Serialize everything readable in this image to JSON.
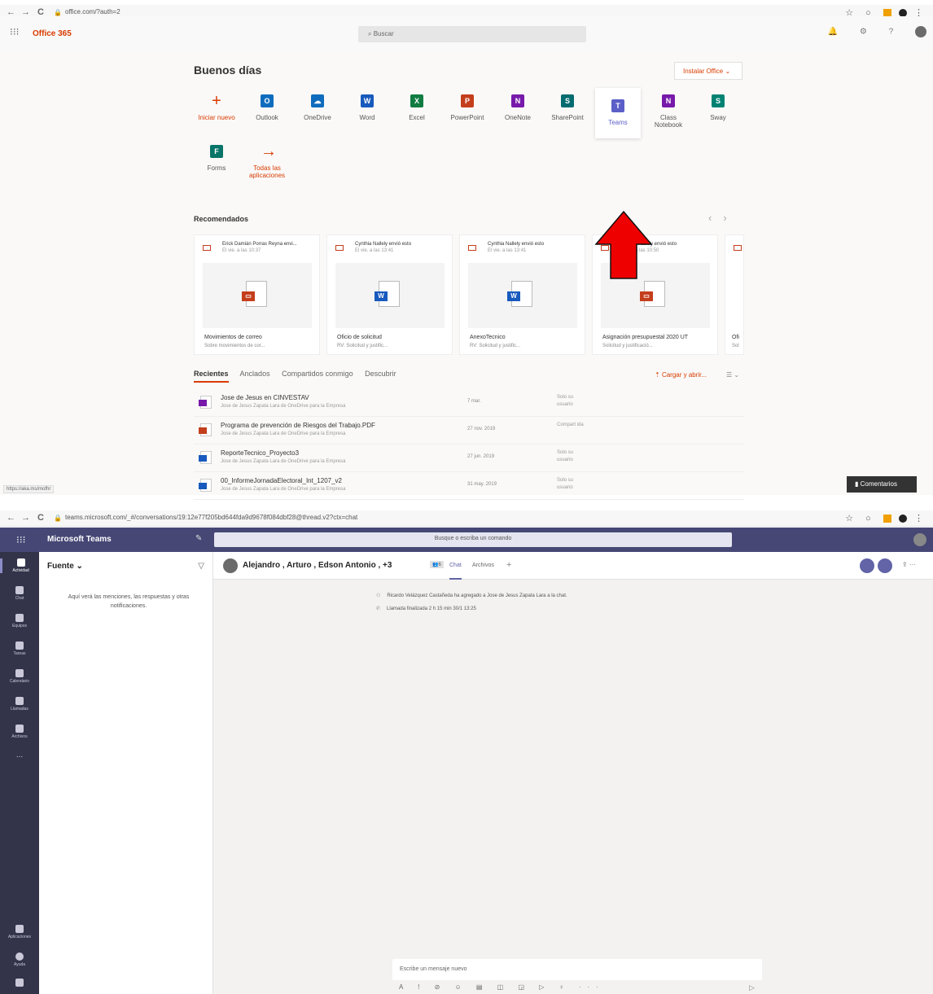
{
  "browser1": {
    "back": "←",
    "forward": "→",
    "reload": "C",
    "lock": "🔒",
    "url": "office.com/?auth=2"
  },
  "office": {
    "waffle": "⁝⁝⁝",
    "title": "Office 365",
    "search_placeholder": "Buscar",
    "greeting": "Buenos días",
    "install_label": "Instalar Office",
    "apps": [
      {
        "label": "Iniciar nuevo",
        "icon": "+",
        "color": "#d83b01"
      },
      {
        "label": "Outlook",
        "icon": "O",
        "color": "#0f6cbd"
      },
      {
        "label": "OneDrive",
        "icon": "☁",
        "color": "#0f6cbd"
      },
      {
        "label": "Word",
        "icon": "W",
        "color": "#185abd"
      },
      {
        "label": "Excel",
        "icon": "X",
        "color": "#107c41"
      },
      {
        "label": "PowerPoint",
        "icon": "P",
        "color": "#c43e1c"
      },
      {
        "label": "OneNote",
        "icon": "N",
        "color": "#7719aa"
      },
      {
        "label": "SharePoint",
        "icon": "S",
        "color": "#036c70"
      },
      {
        "label": "Teams",
        "icon": "T",
        "color": "#5b5fc7"
      },
      {
        "label": "Class Notebook",
        "icon": "N",
        "color": "#7719aa"
      },
      {
        "label": "Sway",
        "icon": "S",
        "color": "#008272"
      },
      {
        "label": "Forms",
        "icon": "F",
        "color": "#077568"
      },
      {
        "label": "Todas las aplicaciones",
        "icon": "→",
        "color": "#d83b01"
      }
    ],
    "recommended_title": "Recomendados",
    "pager_prev": "‹",
    "pager_next": "›",
    "cards": [
      {
        "who": "Erick Damián Porras Reyna envi...",
        "when": "El vie. a las 10:37",
        "type": "pdf",
        "file": "Movimientos de correo",
        "sub": "Sobre movimientos de cor..."
      },
      {
        "who": "Cynthia Nallely envió esto",
        "when": "El vie. a las 13:41",
        "type": "word",
        "file": "Oficio de solicitud",
        "sub": "RV: Solicitud y justific..."
      },
      {
        "who": "Cynthia Nallely envió esto",
        "when": "El vie. a las 13:41",
        "type": "word",
        "file": "AnexoTecnico",
        "sub": "RV: Solicitud y justific..."
      },
      {
        "who": "Cynthia Nallely envió esto",
        "when": "El vie. a las 10:50",
        "type": "pdf",
        "file": "Asignación presupuestal 2020 UT",
        "sub": "Solicitud y justificació..."
      },
      {
        "who": "",
        "when": "",
        "type": "pdf",
        "file": "Ofi",
        "sub": "Sol"
      }
    ],
    "tabs": [
      "Recientes",
      "Anclados",
      "Compartidos conmigo",
      "Descubrir"
    ],
    "upload_label": "Cargar y abrir...",
    "list_icon": "☰ ⌄",
    "files": [
      {
        "name": "Jose de Jesus en CINVESTAV",
        "loc": "Jose de Jesus Zapata Lara de OneDrive para la Empresa",
        "date": "7 mar.",
        "share": "Solo su usuario",
        "color": "#7719aa"
      },
      {
        "name": "Programa de prevención de Riesgos del Trabajo.PDF",
        "loc": "Jose de Jesus Zapata Lara de OneDrive para la Empresa",
        "date": "27 nov. 2019",
        "share": "Compart ida",
        "color": "#c43e1c"
      },
      {
        "name": "ReporteTecnico_Proyecto3",
        "loc": "Jose de Jesus Zapata Lara de OneDrive para la Empresa",
        "date": "27 jun. 2019",
        "share": "Solo su usuario",
        "color": "#185abd"
      },
      {
        "name": "00_InformeJornadaElectoral_Int_1207_v2",
        "loc": "Jose de Jesus Zapata Lara de OneDrive para la Empresa",
        "date": "31 may. 2019",
        "share": "Solo su usuario",
        "color": "#185abd"
      }
    ],
    "status_url": "https://aka.ms/mofhr",
    "feedback": "Comentarios"
  },
  "browser2": {
    "url": "teams.microsoft.com/_#/conversations/19:12e77f205bd644fda9d9678f084dbf28@thread.v2?ctx=chat"
  },
  "teams": {
    "waffle": "⁝⁝⁝",
    "title": "Microsoft Teams",
    "compose_icon": "✎",
    "search_placeholder": "Busque o escriba un comando",
    "rail": [
      "Actividad",
      "Chat",
      "Equipos",
      "Tareas",
      "Calendario",
      "Llamadas",
      "Archivos",
      "...",
      "Aplicaciones",
      "Ayuda"
    ],
    "feed_title": "Fuente",
    "feed_filter": "▽",
    "feed_message": "Aquí verá las menciones, las respuestas y otras notificaciones.",
    "chat_names": "Alejandro , Arturo , Edson Antonio , +3",
    "participants": "6",
    "tab_chat": "Chat",
    "tab_files": "Archivos",
    "tab_add": "+",
    "sys_added": "Ricardo Velázquez Castañeda ha agregado a Jose de Jesus Zapata Lara a la chat.",
    "sys_call": "Llamada finalizada  2 h 15 min   30/1 13:25",
    "compose_placeholder": "Escribe un mensaje nuevo",
    "compose_tools": "A ! ⊘ ☺ ▤ ◫ ◲ ▷ ♀ ···",
    "send": "▷"
  }
}
